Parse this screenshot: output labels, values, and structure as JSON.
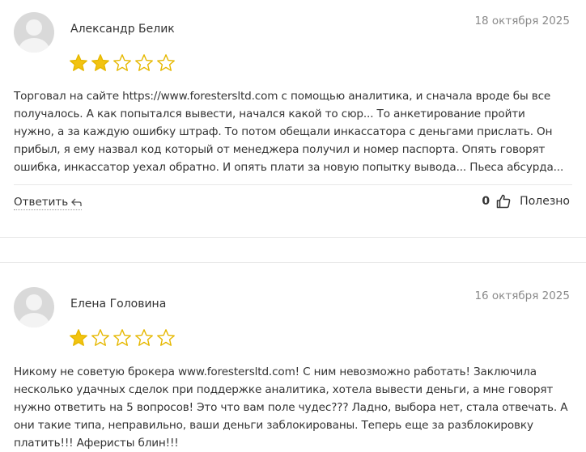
{
  "reviews": [
    {
      "author": "Александр Белик",
      "date": "18 октября 2025",
      "rating": 2,
      "max_rating": 5,
      "lines": [
        "Торговал на сайте https://www.forestersltd.com с помощью аналитика, и сначала вроде бы все",
        "получалось. А как попытался вывести, начался какой то сюр... То анкетирование пройти",
        "нужно, а за каждую ошибку штраф. То потом обещали инкассатора с деньгами прислать. Он",
        "прибыл, я ему назвал код который от менеджера получил и номер паспорта. Опять говорят",
        "ошибка, инкассатор уехал обратно. И опять плати за новую попытку вывода... Пьеса абсурда..."
      ],
      "reply_label": "Ответить",
      "likes": "0",
      "useful_label": "Полезно"
    },
    {
      "author": "Елена Головина",
      "date": "16 октября 2025",
      "rating": 1,
      "max_rating": 5,
      "lines": [
        "Никому не советую брокера www.forestersltd.com! С ним невозможно работать! Заключила",
        "несколько удачных сделок при поддержке аналитика, хотела вывести деньги, а мне говорят",
        "нужно ответить на 5 вопросов! Это что вам поле чудес??? Ладно, выбора нет, стала отвечать. А",
        "они такие типа, неправильно, ваши деньги заблокированы. Теперь еще за разблокировку",
        "платить!!! Аферисты блин!!!"
      ]
    }
  ],
  "colors": {
    "star_fill": "#f2c311",
    "star_stroke": "#e6b800",
    "avatar_bg": "#d9d9d9",
    "date": "#8a8a8a"
  },
  "icons": {
    "star": "star-icon",
    "reply": "reply-arrow-icon",
    "like": "thumbs-up-icon",
    "avatar": "user-avatar-icon"
  }
}
